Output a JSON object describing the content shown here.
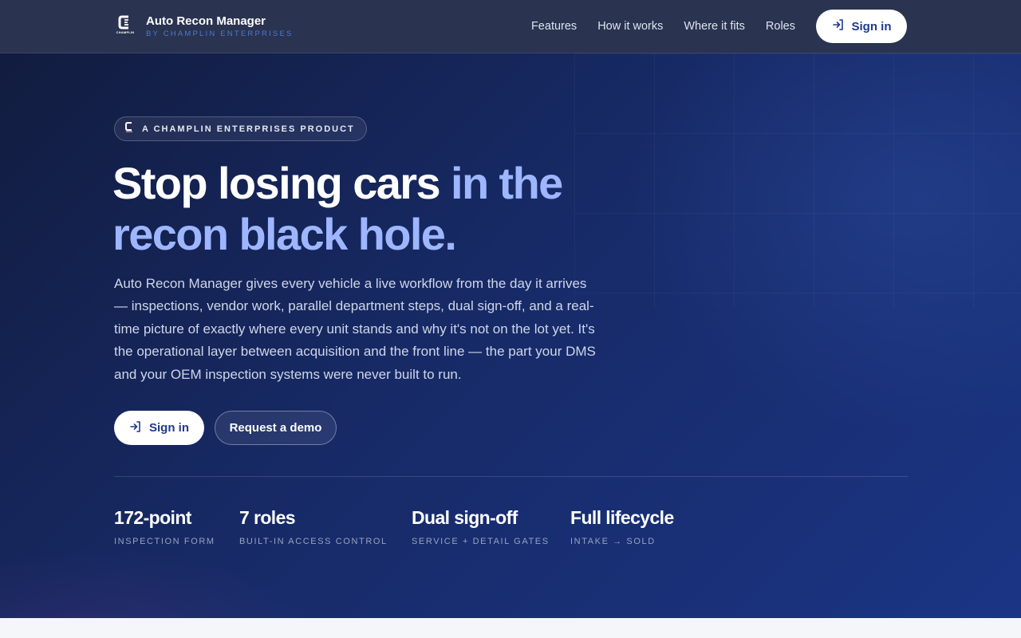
{
  "header": {
    "brand_name": "Auto Recon Manager",
    "brand_sub": "BY CHAMPLIN ENTERPRISES",
    "logo_caption": "CHAMPLIN",
    "nav": [
      "Features",
      "How it works",
      "Where it fits",
      "Roles"
    ],
    "signin_label": "Sign in"
  },
  "hero": {
    "eyebrow": "A CHAMPLIN ENTERPRISES PRODUCT",
    "headline_plain": "Stop losing cars ",
    "headline_accent": "in the recon black hole.",
    "lead": "Auto Recon Manager gives every vehicle a live workflow from the day it arrives — inspections, vendor work, parallel department steps, dual sign-off, and a real-time picture of exactly where every unit stands and why it's not on the lot yet. It's the operational layer between acquisition and the front line — the part your DMS and your OEM inspection systems were never built to run.",
    "cta_primary": "Sign in",
    "cta_secondary": "Request a demo"
  },
  "stats": [
    {
      "value": "172-point",
      "label": "INSPECTION FORM"
    },
    {
      "value": "7 roles",
      "label": "BUILT-IN ACCESS CONTROL"
    },
    {
      "value": "Dual sign-off",
      "label": "SERVICE + DETAIL GATES"
    },
    {
      "value": "Full lifecycle",
      "label": "INTAKE → SOLD"
    }
  ],
  "colors": {
    "accent": "#9db6ff",
    "header_bg": "#2a3350",
    "button_text": "#1f3a8a"
  },
  "icons": {
    "logo": "champlin-logo-icon",
    "sign_in": "sign-in-arrow-icon"
  }
}
